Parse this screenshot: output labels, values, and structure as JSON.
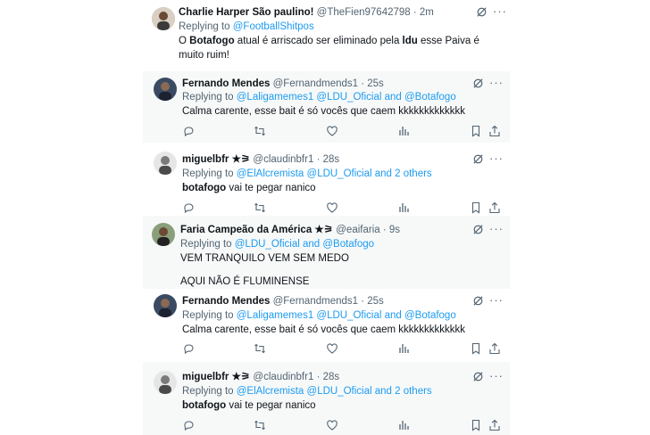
{
  "tweets": [
    {
      "name": "Charlie Harper São paulino!",
      "handle": "@TheFien97642798",
      "time": "· 2m",
      "reply_prefix": "Replying to",
      "reply_to": "@FootballShitpos",
      "body_parts": [
        "O ",
        "Botafogo",
        " atual é arriscado ser eliminado pela ",
        "ldu",
        " esse Paiva é muito ruim!"
      ]
    },
    {
      "name": "Fernando Mendes",
      "handle": "@Fernandmends1",
      "time": "· 25s",
      "reply_prefix": "Replying to",
      "reply_to": "@Laligamemes1 @LDU_Oficial and @Botafogo",
      "body": "Calma carente, esse bait é só vocês que caem kkkkkkkkkkkkk"
    },
    {
      "name": "miguelbfr ★⚞",
      "handle": "@claudinbfr1",
      "time": "· 28s",
      "reply_prefix": "Replying to",
      "reply_to": "@ElAlcremista @LDU_Oficial and 2 others",
      "body_bold": "botafogo",
      "body_rest": " vai te pegar nanico"
    },
    {
      "name": "Faria Campeão da América ★⚞",
      "handle": "@eaifaria",
      "time": "· 9s",
      "reply_prefix": "Replying to",
      "reply_to": "@LDU_Oficial and @Botafogo",
      "body_line1": "VEM TRANQUILO VEM SEM MEDO",
      "body_line2": "AQUI NÃO É FLUMINENSE"
    },
    {
      "name": "Fernando Mendes",
      "handle": "@Fernandmends1",
      "time": "· 25s",
      "reply_prefix": "Replying to",
      "reply_to": "@Laligamemes1 @LDU_Oficial and @Botafogo",
      "body": "Calma carente, esse bait é só vocês que caem kkkkkkkkkkkkk"
    },
    {
      "name": "miguelbfr ★⚞",
      "handle": "@claudinbfr1",
      "time": "· 28s",
      "reply_prefix": "Replying to",
      "reply_to": "@ElAlcremista @LDU_Oficial and 2 others",
      "body_bold": "botafogo",
      "body_rest": " vai te pegar nanico"
    }
  ],
  "icons": {
    "more": "more-icon",
    "grok": "grok-icon",
    "reply": "reply-icon",
    "retweet": "retweet-icon",
    "like": "like-icon",
    "views": "views-icon",
    "bookmark": "bookmark-icon",
    "share": "share-icon"
  },
  "colors": {
    "link": "#1d9bf0",
    "secondary_text": "#536471",
    "gray_bg": "#f7f9f9"
  }
}
